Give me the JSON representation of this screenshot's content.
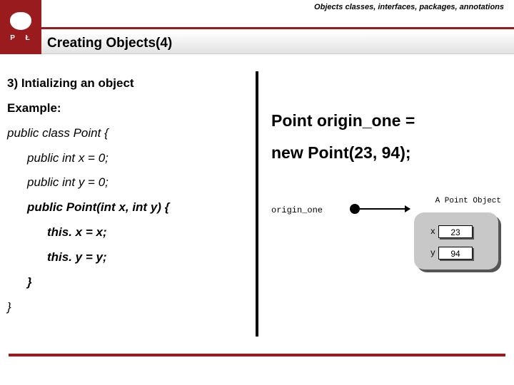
{
  "header": {
    "logo_letters": "P Ł",
    "topic": "Objects classes, interfaces, packages, annotations",
    "title": "Creating Objects(4)"
  },
  "left": {
    "heading": "3) Intializing an object",
    "example_label": "Example:",
    "l1": "public class Point {",
    "l2": "public int x = 0;",
    "l3": "public int y = 0;",
    "l4": "public Point(int x, int y) {",
    "l5": "this. x = x;",
    "l6": "this. y = y;",
    "l7": "}",
    "l8": "}"
  },
  "right": {
    "stmt1": "Point origin_one =",
    "stmt2": "new Point(23, 94);"
  },
  "diagram": {
    "ref_label": "origin_one",
    "obj_label": "A Point Object",
    "field_x_label": "x",
    "field_y_label": "y",
    "field_x_value": "23",
    "field_y_value": "94"
  }
}
